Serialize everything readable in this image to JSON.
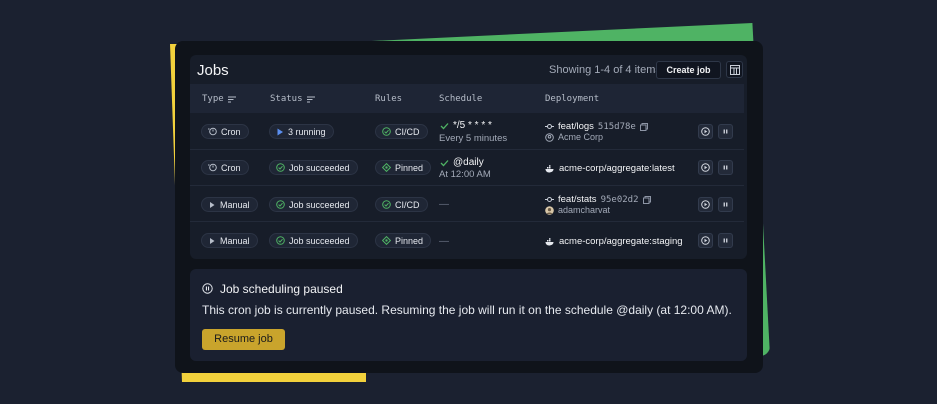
{
  "colors": {
    "accent_yellow": "#f2d13c",
    "accent_green": "#4fb364",
    "button_gold": "#c9a42c",
    "success": "#4fb364"
  },
  "header": {
    "title": "Jobs",
    "showing": "Showing 1-4 of 4 items",
    "create_label": "Create job",
    "columns_icon": "columns-icon"
  },
  "table": {
    "columns": [
      "Type",
      "Status",
      "Rules",
      "Schedule",
      "Deployment"
    ],
    "rows": [
      {
        "type": "Cron",
        "type_icon": "cron-icon",
        "status": "3 running",
        "status_icon": "play-icon",
        "rule": "CI/CD",
        "rule_icon": "check-circle-icon",
        "schedule": "*/5 * * * *",
        "schedule_sub": "Every 5 minutes",
        "deploy": "feat/logs",
        "deploy_sha": "515d78e",
        "deploy_sub": "Acme Corp",
        "deploy_icon": "git-commit-icon"
      },
      {
        "type": "Cron",
        "type_icon": "cron-icon",
        "status": "Job succeeded",
        "status_icon": "check-circle-icon",
        "rule": "Pinned",
        "rule_icon": "pin-icon",
        "schedule": "@daily",
        "schedule_sub": "At 12:00 AM",
        "deploy": "acme-corp/aggregate:latest",
        "deploy_icon": "docker-icon"
      },
      {
        "type": "Manual",
        "type_icon": "play-icon",
        "status": "Job succeeded",
        "status_icon": "check-circle-icon",
        "rule": "CI/CD",
        "rule_icon": "check-circle-icon",
        "schedule": "—",
        "deploy": "feat/stats",
        "deploy_sha": "95e02d2",
        "deploy_sub": "adamcharvat",
        "deploy_icon": "git-commit-icon"
      },
      {
        "type": "Manual",
        "type_icon": "play-icon",
        "status": "Job succeeded",
        "status_icon": "check-circle-icon",
        "rule": "Pinned",
        "rule_icon": "pin-icon",
        "schedule": "—",
        "deploy": "acme-corp/aggregate:staging",
        "deploy_icon": "docker-icon"
      }
    ]
  },
  "notice": {
    "title": "Job scheduling paused",
    "body": "This cron job is currently paused. Resuming the job will run it on the schedule @daily (at 12:00 AM).",
    "button": "Resume job"
  }
}
